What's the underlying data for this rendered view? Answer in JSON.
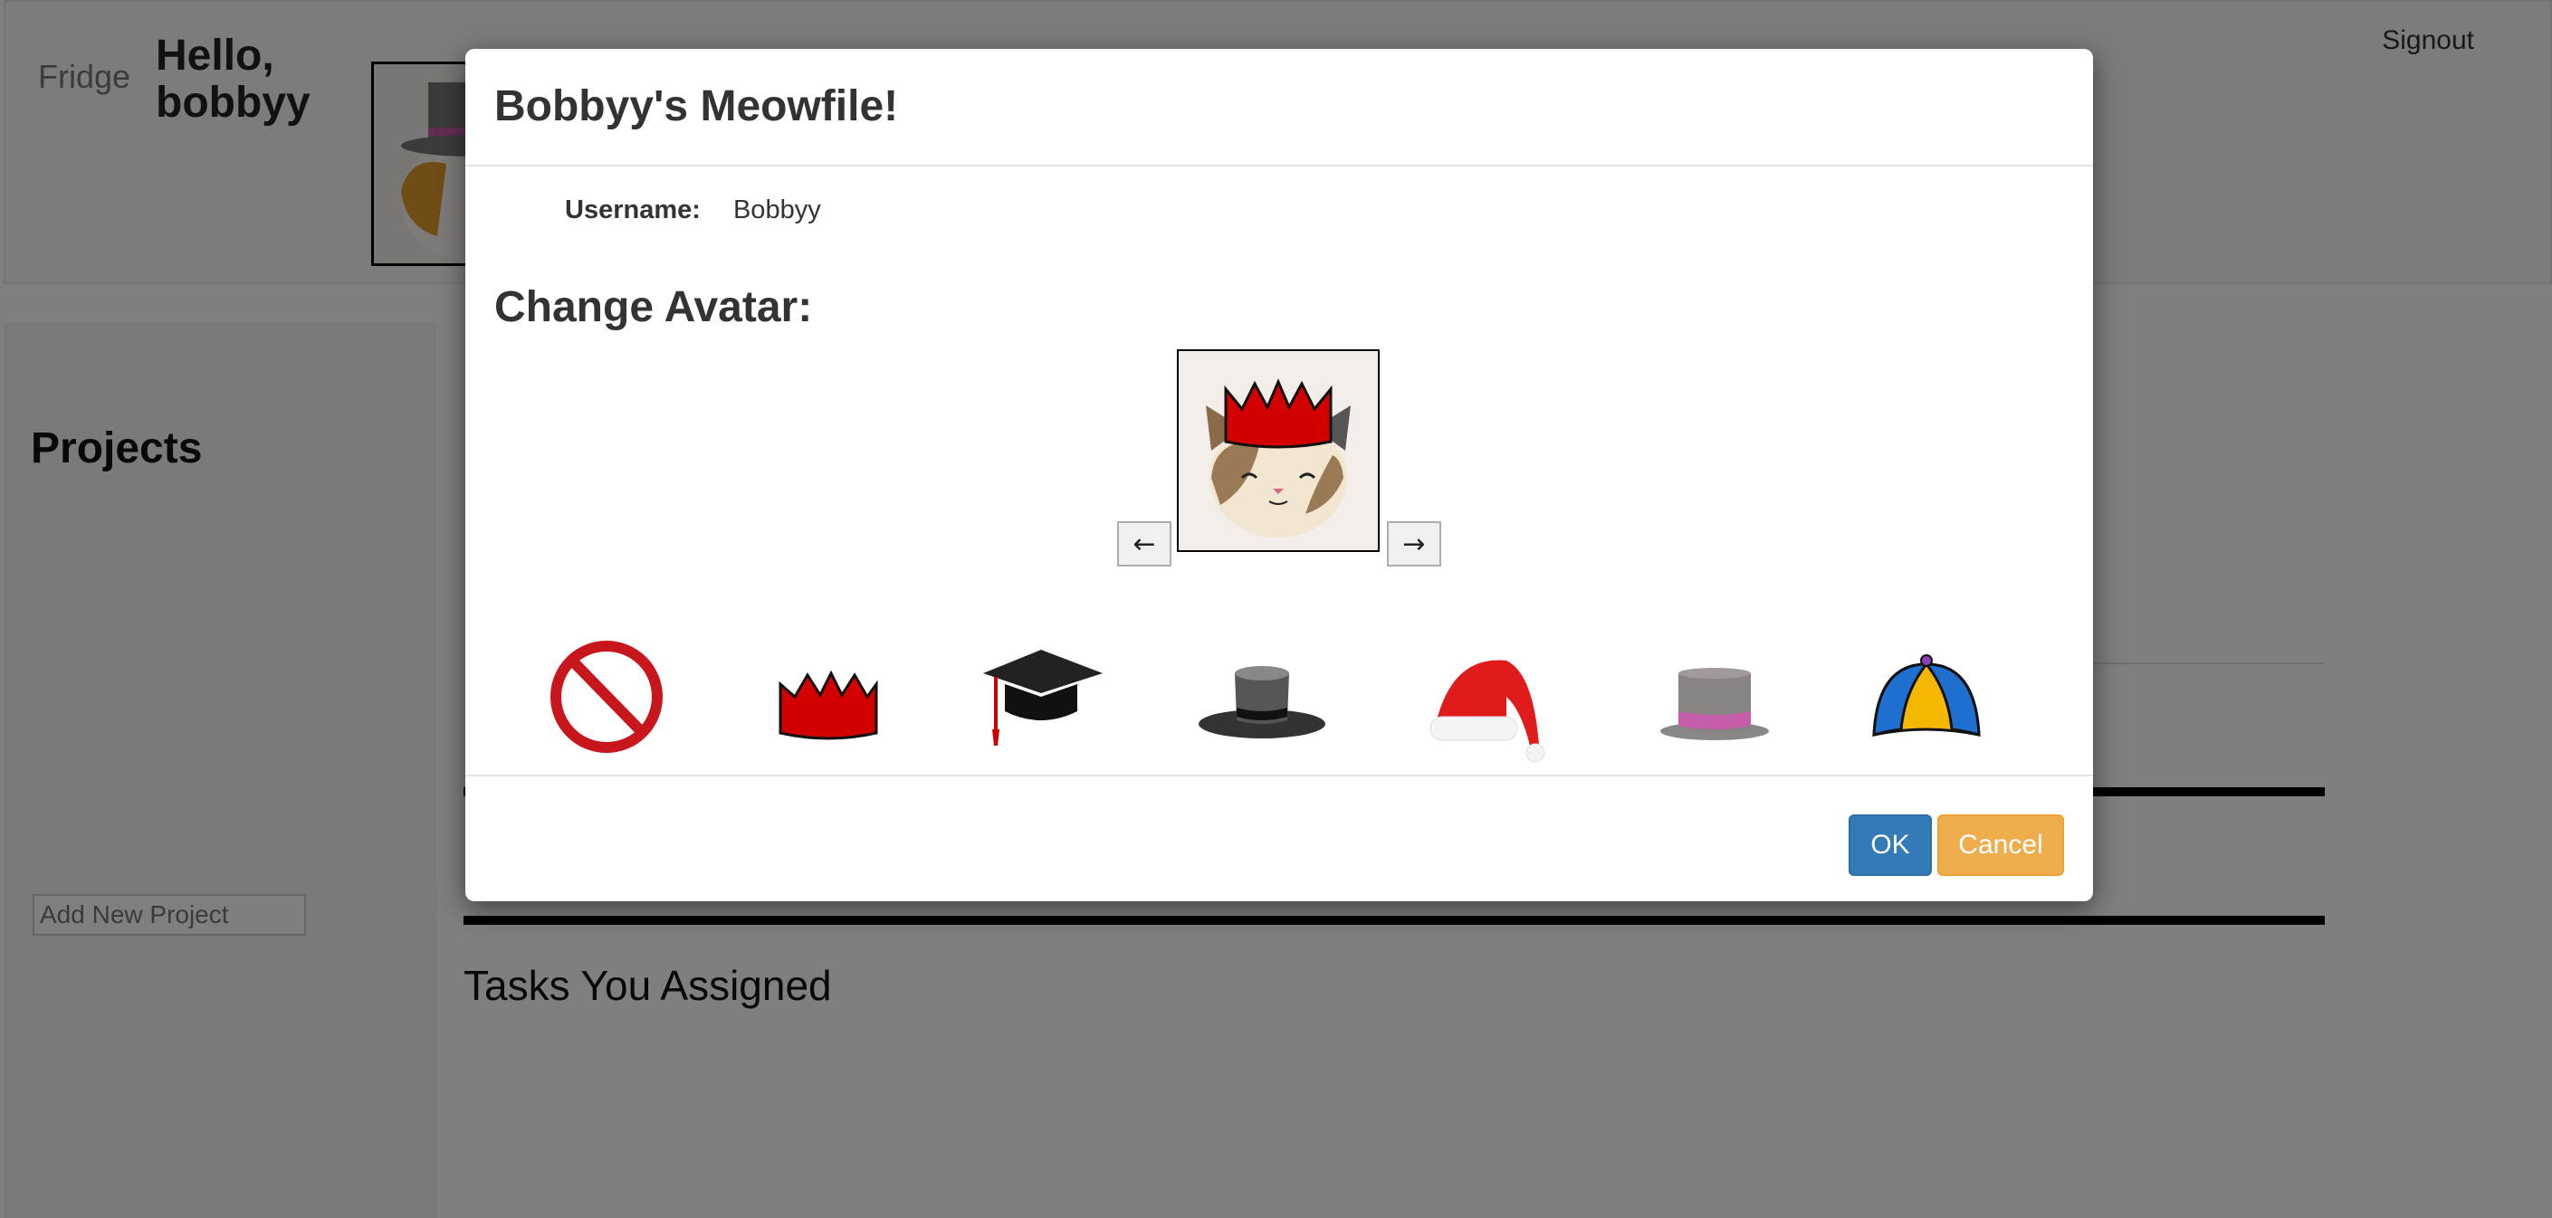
{
  "nav": {
    "brand": "Fridge",
    "greeting": "Hello, bobbyy",
    "signout": "Signout"
  },
  "sidebar": {
    "title": "Projects",
    "add_placeholder": "Add New Project"
  },
  "main": {
    "tasks_title": "Tasks You Assigned"
  },
  "modal": {
    "title": "Bobbyy's Meowfile!",
    "username_label": "Username:",
    "username_value": "Bobbyy",
    "avatar_title": "Change Avatar:",
    "prev_arrow": "←",
    "next_arrow": "→",
    "ok_label": "OK",
    "cancel_label": "Cancel",
    "hat_options": [
      "no-hat",
      "crown",
      "graduation-cap",
      "black-top-hat",
      "santa-hat",
      "gray-top-hat",
      "propeller-beanie"
    ]
  },
  "colors": {
    "ok": "#337ab7",
    "cancel": "#f0ad4e",
    "crown": "#d30000"
  }
}
